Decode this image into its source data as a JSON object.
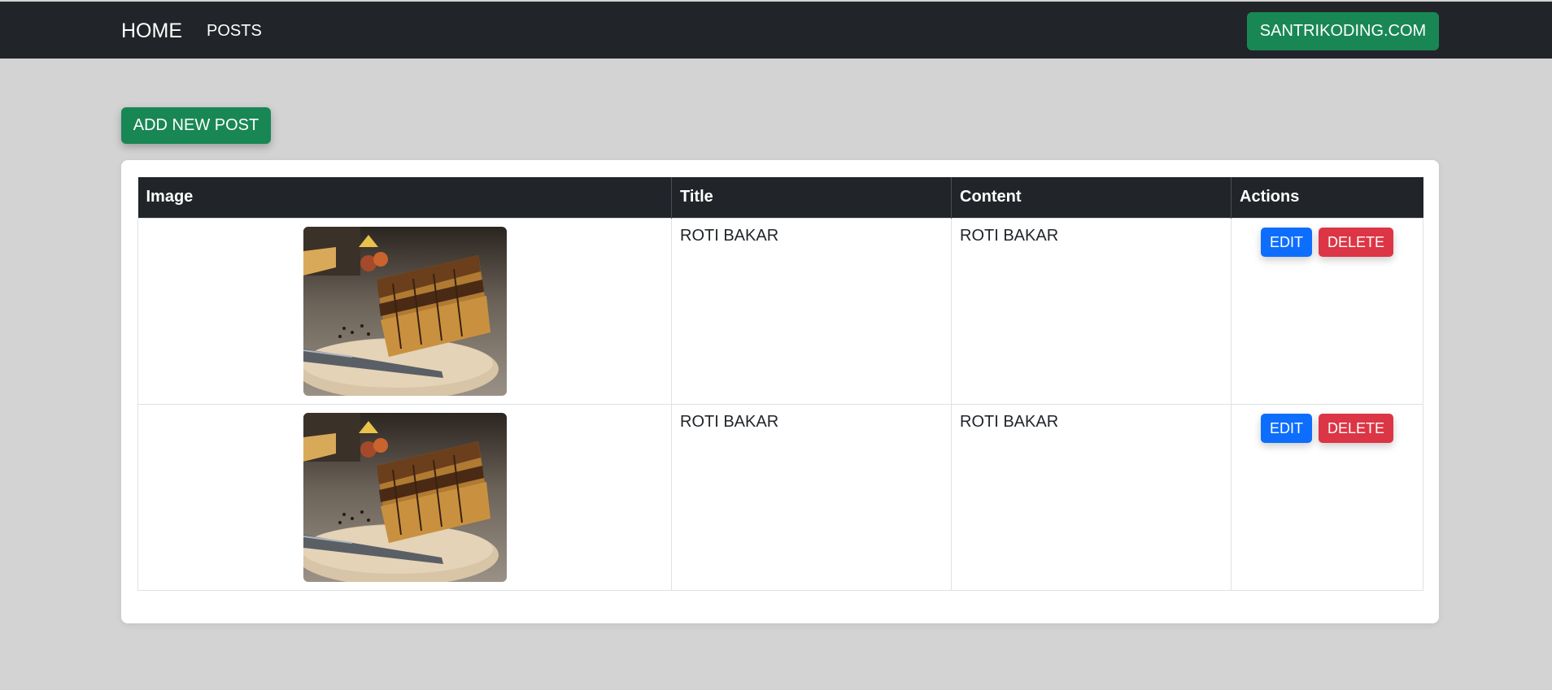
{
  "nav": {
    "brand": "HOME",
    "links": [
      "POSTS"
    ],
    "site_button": "SANTRIKODING.COM"
  },
  "actions": {
    "add_label": "ADD NEW POST"
  },
  "table": {
    "headers": [
      "Image",
      "Title",
      "Content",
      "Actions"
    ],
    "rows": [
      {
        "title": "ROTI BAKAR",
        "content": "ROTI BAKAR",
        "edit": "EDIT",
        "delete": "DELETE"
      },
      {
        "title": "ROTI BAKAR",
        "content": "ROTI BAKAR",
        "edit": "EDIT",
        "delete": "DELETE"
      }
    ]
  },
  "colors": {
    "navbar": "#212529",
    "success": "#198754",
    "primary": "#0d6efd",
    "danger": "#dc3545",
    "page_bg": "#d3d3d3"
  }
}
